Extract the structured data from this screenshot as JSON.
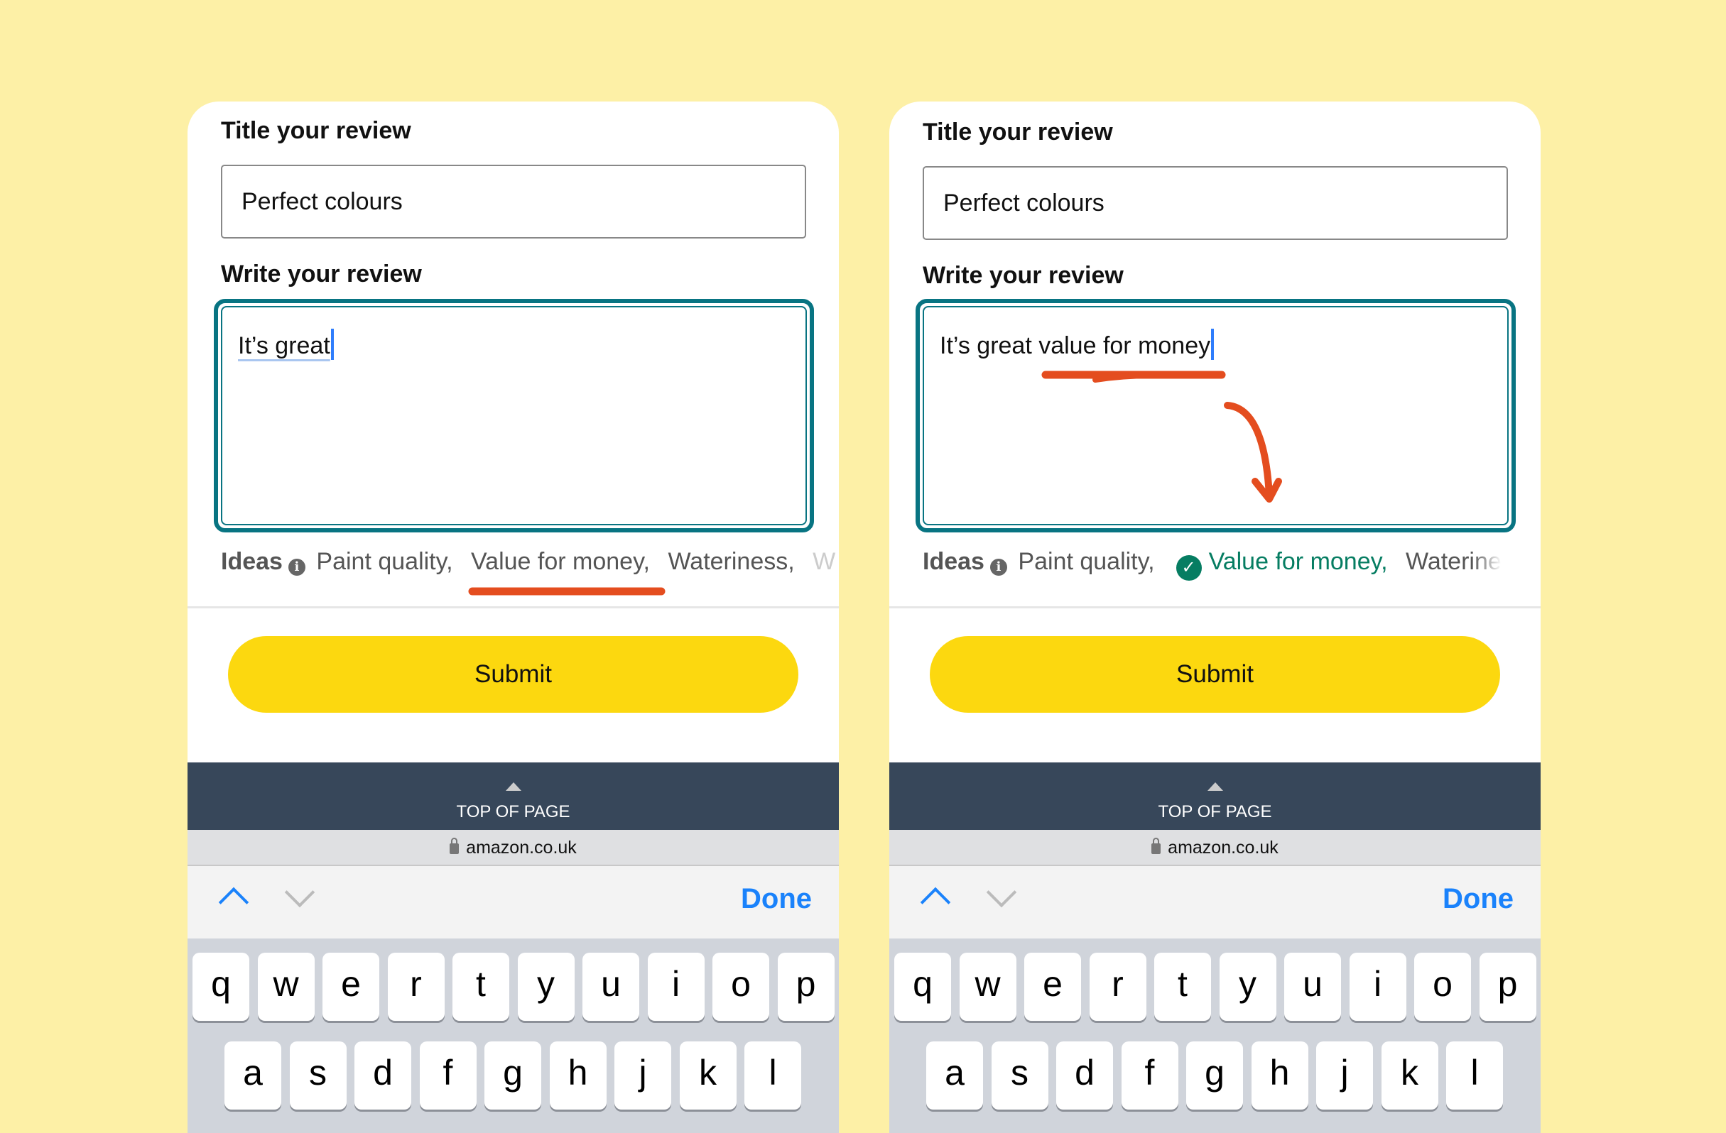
{
  "panels": [
    {
      "title_label": "Title your review",
      "title_value": "Perfect colours",
      "review_label": "Write your review",
      "review_value": "It’s great",
      "ideas_label": "Ideas",
      "ideas": [
        "Paint quality,",
        "Value for money,",
        "Wateriness,",
        "W"
      ],
      "selected_idea": null,
      "submit": "Submit",
      "top_of_page": "TOP OF PAGE",
      "url": "amazon.co.uk",
      "done": "Done"
    },
    {
      "title_label": "Title your review",
      "title_value": "Perfect colours",
      "review_label": "Write your review",
      "review_value": "It’s great value for money",
      "ideas_label": "Ideas",
      "ideas": [
        "Paint quality,",
        "Value for money,",
        "Waterine"
      ],
      "selected_idea": "Value for money,",
      "submit": "Submit",
      "top_of_page": "TOP OF PAGE",
      "url": "amazon.co.uk",
      "done": "Done"
    }
  ],
  "keyboard": {
    "row1": [
      "q",
      "w",
      "e",
      "r",
      "t",
      "y",
      "u",
      "i",
      "o",
      "p"
    ],
    "row2": [
      "a",
      "s",
      "d",
      "f",
      "g",
      "h",
      "j",
      "k",
      "l"
    ]
  },
  "colors": {
    "background": "#fdf0a6",
    "focus_border": "#087482",
    "submit": "#fcd80f",
    "footer": "#37475a",
    "accent_blue": "#1a82fb",
    "selected_green": "#067d62",
    "annotation": "#e44d1f"
  }
}
